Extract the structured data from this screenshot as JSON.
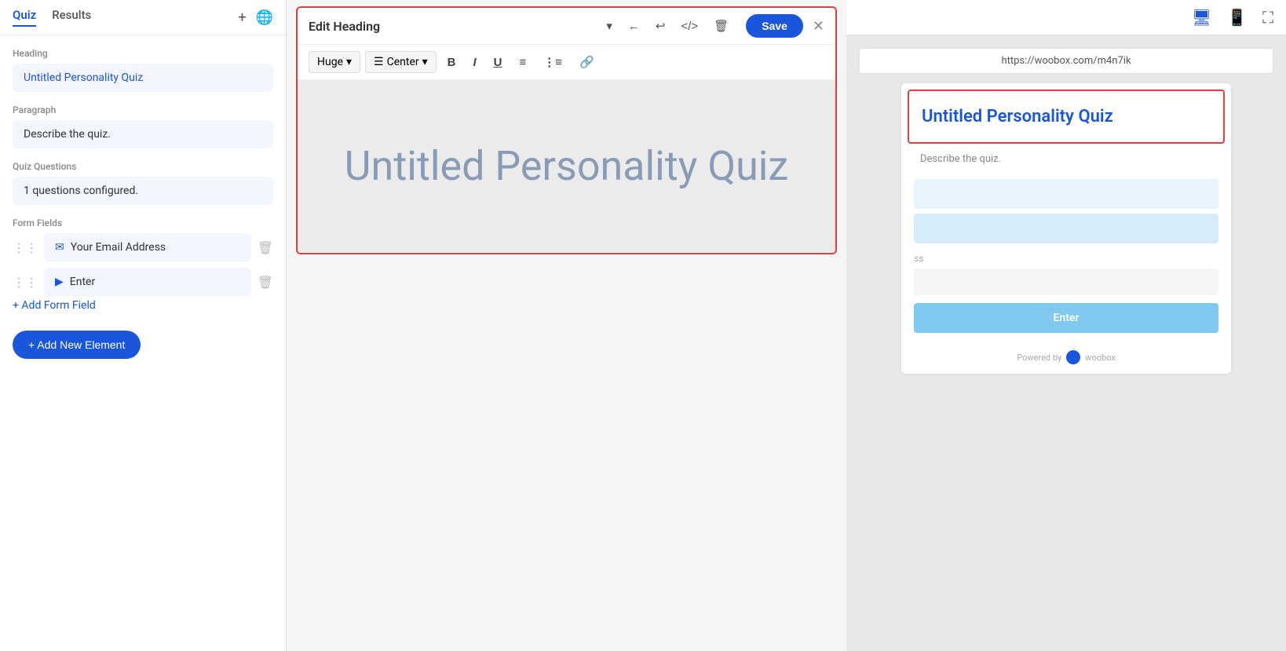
{
  "sidebar": {
    "tabs": [
      {
        "label": "Quiz",
        "active": true
      },
      {
        "label": "Results",
        "active": false
      }
    ],
    "sections": {
      "heading": {
        "label": "Heading",
        "value": "Untitled Personality Quiz"
      },
      "paragraph": {
        "label": "Paragraph",
        "value": "Describe the quiz."
      },
      "quizQuestions": {
        "label": "Quiz Questions",
        "value": "1 questions configured."
      },
      "formFields": {
        "label": "Form Fields",
        "items": [
          {
            "icon": "✉",
            "label": "Your Email Address"
          },
          {
            "icon": "▶",
            "label": "Enter"
          }
        ],
        "addLabel": "+ Add Form Field"
      }
    },
    "addNewElement": "+ Add New Element"
  },
  "editHeading": {
    "title": "Edit Heading",
    "formatSize": "Huge",
    "formatAlign": "Center",
    "contentText": "Untitled Personality Quiz",
    "saveLabel": "Save"
  },
  "preview": {
    "urlBar": "https://woobox.com/m4n7ik",
    "headingText": "Untitled Personality Quiz",
    "paragraphText": "Describe the quiz.",
    "enterLabel": "Enter",
    "poweredBy": "Powered by",
    "wooboxLabel": "woobox",
    "smallText": "ss"
  }
}
